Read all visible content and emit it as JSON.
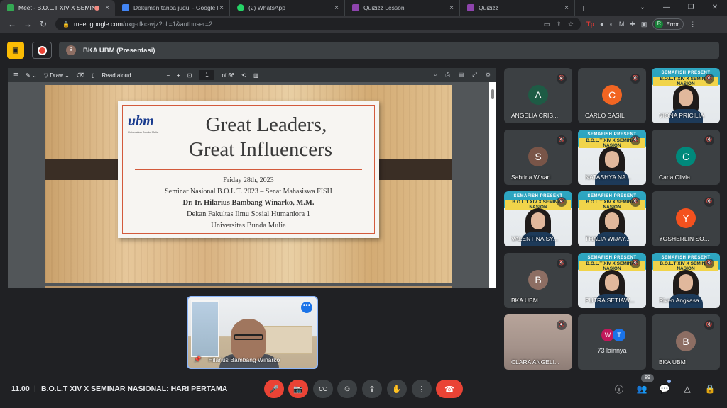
{
  "browser": {
    "tabs": [
      {
        "title": "Meet - B.O.L.T XIV X SEMINA",
        "fav_color": "#34a853",
        "active": true,
        "recording": true
      },
      {
        "title": "Dokumen tanpa judul - Google D",
        "fav_color": "#4285f4",
        "active": false
      },
      {
        "title": "(2) WhatsApp",
        "fav_color": "#25d366",
        "active": false
      },
      {
        "title": "Quizizz Lesson",
        "fav_color": "#8e44ad",
        "active": false
      },
      {
        "title": "Quizizz",
        "fav_color": "#8e44ad",
        "active": false
      }
    ],
    "close_glyph": "×",
    "new_tab_glyph": "+",
    "window_controls": [
      "⌄",
      "—",
      "❐",
      "✕"
    ],
    "nav": {
      "back": "←",
      "forward": "→",
      "reload": "↻"
    },
    "url_host": "meet.google.com",
    "url_path": "/uxg-rfkc-wjz?pli=1&authuser=2",
    "omnibox_icons": [
      "▭",
      "⇪",
      "☆"
    ],
    "extensions": {
      "tp": "Tp",
      "others": [
        "●",
        "◐",
        "M",
        "✚",
        "▣"
      ]
    },
    "profile_initial": "R",
    "error_label": "Error",
    "menu_glyph": "⋮"
  },
  "meet": {
    "presenting_initial": "B",
    "presenting_label": "BKA UBM (Presentasi)",
    "pdf": {
      "menu_glyph": "☰",
      "draw_label": "Draw",
      "read_aloud_label": "Read aloud",
      "zoom_minus": "−",
      "zoom_plus": "+",
      "page_current": "1",
      "page_total": "of 56",
      "right_icons": [
        "⌕",
        "⎙",
        "▤",
        "⤢",
        "⚙"
      ]
    },
    "slide": {
      "logo_text": "ubm",
      "logo_sub": "Universitas Bunda Mulia",
      "title_line1": "Great Leaders,",
      "title_line2": "Great Influencers",
      "date": "Friday 28th, 2023",
      "event": "Seminar Nasional B.O.L.T. 2023 – Senat Mahasiswa FISH",
      "speaker": "Dr. Ir. Hilarius Bambang Winarko, M.M.",
      "position": "Dekan Fakultas Ilmu Sosial Humaniora 1",
      "university": "Universitas Bunda Mulia"
    },
    "pinned": {
      "name": "Hilarius Bambang Winarko",
      "more": "•••",
      "pin": "📌"
    },
    "video_banner": "SEMAFISH PRESENT",
    "video_banner2": "B.O.L.T XIV X SEMINAR NASION",
    "participants": [
      {
        "name": "ANGELIA CRIS...",
        "initial": "A",
        "color": "#1e5b45",
        "type": "avatar"
      },
      {
        "name": "CARLO SASIL",
        "initial": "C",
        "color": "#f26522",
        "type": "avatar"
      },
      {
        "name": "VIONA PRICILIA",
        "type": "video"
      },
      {
        "name": "Sabrina Wisari",
        "initial": "S",
        "color": "#795548",
        "type": "avatar"
      },
      {
        "name": "NATASHYA NA...",
        "type": "video"
      },
      {
        "name": "Carla Olivia",
        "initial": "C",
        "color": "#00897b",
        "type": "avatar"
      },
      {
        "name": "VALENTINA SY...",
        "type": "video"
      },
      {
        "name": "THALIA WIJAY...",
        "type": "video"
      },
      {
        "name": "YOSHERLIN SO...",
        "initial": "Y",
        "color": "#f4511e",
        "type": "avatar"
      },
      {
        "name": "BKA UBM",
        "initial": "B",
        "color": "#8d6e63",
        "type": "avatar"
      },
      {
        "name": "PUTRA SETIAW...",
        "type": "video"
      },
      {
        "name": "Riven Angkasa",
        "type": "video"
      },
      {
        "name": "CLARA ANGELI...",
        "type": "clara"
      },
      {
        "name": "73 lainnya",
        "type": "more",
        "mini": [
          {
            "initial": "W",
            "color": "#c2185b"
          },
          {
            "initial": "T",
            "color": "#1a73e8"
          }
        ]
      },
      {
        "name": "BKA UBM",
        "initial": "B",
        "color": "#8d6e63",
        "type": "avatar"
      }
    ],
    "muted_glyph": "🔇"
  },
  "bottombar": {
    "time": "11.00",
    "separator": "|",
    "meeting_name": "B.O.L.T XIV X SEMINAR NASIONAL: HARI PERTAMA",
    "participant_count": "89",
    "controls": [
      "🎤",
      "📷",
      "CC",
      "☺",
      "⇪",
      "✋",
      "⋮",
      "☎"
    ],
    "right": [
      "ⓘ",
      "👥",
      "💬",
      "△",
      "🔒"
    ]
  }
}
